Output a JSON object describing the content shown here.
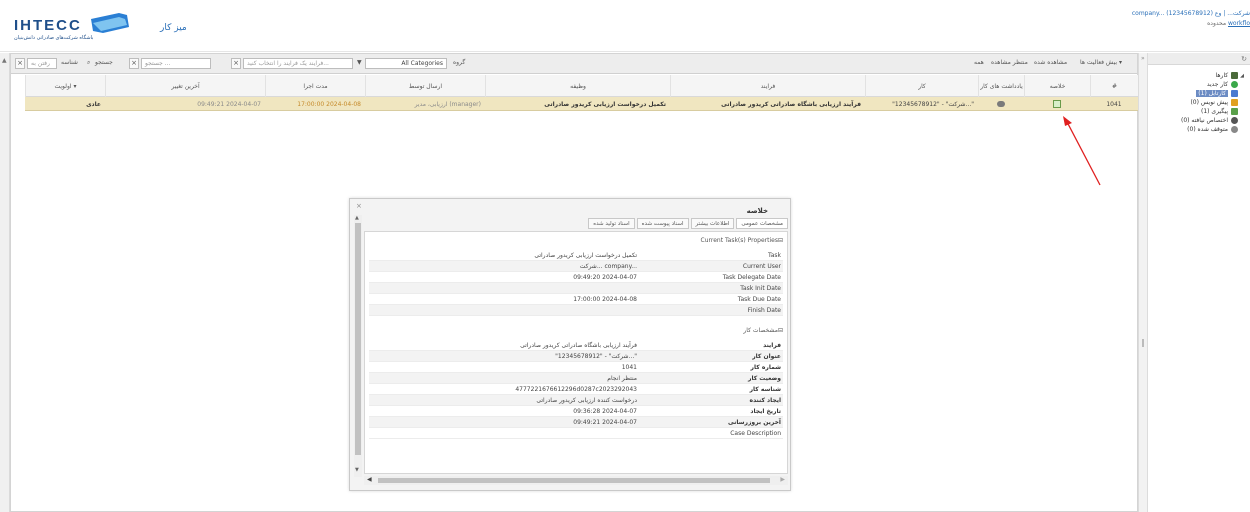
{
  "header": {
    "logo_text": "IHTECC",
    "logo_sub": "باشگاه شرکت‌های صادراتی دانش‌بنیان",
    "home_link": "میز کار",
    "user_line1": "company... (12345678912) شرکت... | وع",
    "user_line2_prefix": "محدوده",
    "user_line2_link": "workflo"
  },
  "toolbar": {
    "actions_menu": "بیش فعالیت ها ▾",
    "view_read": "مشاهده شده",
    "view_pending": "منتظر مشاهده",
    "view_all": "همه",
    "group_label": "گروه",
    "category_value": "All Categories",
    "process_placeholder": "فرایند یک فرایند را انتخاب کنید...",
    "search_placeholder": "جستجو ...",
    "search_label": "جستجو",
    "id_label": "شناسه",
    "id_input": "رفتن به"
  },
  "grid": {
    "columns": [
      "#",
      "خلاصه",
      "یادداشت های کار",
      "کار",
      "فرایند",
      "وظیفه",
      "ارسال توسط",
      "مدت اجرا",
      "آخرین تغییر",
      "اولویت ▾"
    ],
    "row": {
      "id": "1041",
      "task": "\"12345678912\" - \"شرکت...\"",
      "process": "فرآیند ارزیابی باشگاه صادراتی کریدور صادراتی",
      "step": "تکمیل درخواست ارزیابی کریدور صادراتی",
      "sent_by": "ارزیابی، مدیر (manager)",
      "due": "17:00:00 2024-04-08",
      "last_modified": "09:49:21 2024-04-07",
      "priority": "عادی"
    }
  },
  "dialog": {
    "title": "خلاصه",
    "close": "×",
    "tabs": [
      "مشخصات عمومی",
      "اطلاعات بیشتر",
      "اسناد پیوست شده",
      "اسناد تولید شده"
    ],
    "section1_title": "Current Task(s) Properties",
    "section1": [
      {
        "label": "Task",
        "value": "تکمیل درخواست ارزیابی کریدور صادراتی"
      },
      {
        "label": "Current User",
        "value": "شرکت... company..."
      },
      {
        "label": "Task Delegate Date",
        "value": "09:49:20 2024-04-07"
      },
      {
        "label": "Task Init Date",
        "value": ""
      },
      {
        "label": "Task Due Date",
        "value": "17:00:00 2024-04-08"
      },
      {
        "label": "Finish Date",
        "value": ""
      }
    ],
    "section2_title": "مشخصات کار",
    "section2": [
      {
        "label": "فرایند",
        "value": "فرآیند ارزیابی باشگاه صادراتی کریدور صادراتی"
      },
      {
        "label": "عنوان کار",
        "value": "\"12345678912\" - \"شرکت...\""
      },
      {
        "label": "شماره کار",
        "value": "1041"
      },
      {
        "label": "وضعیت کار",
        "value": "منتظر انجام"
      },
      {
        "label": "شناسه کار",
        "value": "4777221676612296d0287c2023292043"
      },
      {
        "label": "ایجاد کننده",
        "value": "درخواست کننده ارزیابی کریدور صادراتی"
      },
      {
        "label": "تاریخ ایجاد",
        "value": "09:36:28 2024-04-07"
      },
      {
        "label": "آخرین بروزرسانی",
        "value": "09:49:21 2024-04-07"
      },
      {
        "label": "Case Description",
        "value": ""
      }
    ]
  },
  "tree": {
    "root": "کارها",
    "items": [
      {
        "label": "کار جدید",
        "color": "#3aa84a"
      },
      {
        "label": "کارتابل (1)",
        "color": "#4a7ad0"
      },
      {
        "label": "پیش نویس (0)",
        "color": "#e0a020"
      },
      {
        "label": "پیگیری (1)",
        "color": "#5aa04a"
      },
      {
        "label": "اختصاص نیافته (0)",
        "color": "#555555"
      },
      {
        "label": "متوقف شده (0)",
        "color": "#888888"
      }
    ]
  },
  "colors": {
    "selected_row": "#f0e6c0",
    "link": "#2a6fb8",
    "arrow": "#e02020"
  }
}
